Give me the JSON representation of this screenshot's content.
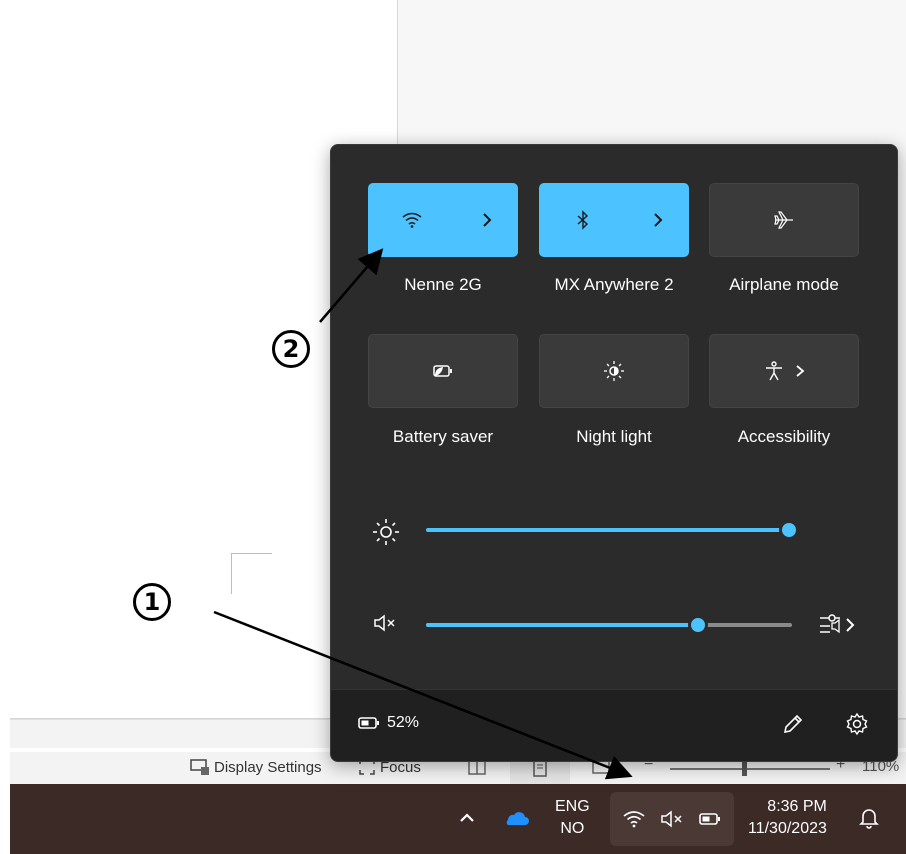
{
  "document": {},
  "statusbar": {
    "display_settings_label": "Display Settings",
    "focus_label": "Focus",
    "zoom_minus": "−",
    "zoom_plus": "+",
    "zoom_level": "110%"
  },
  "quick_settings": {
    "tiles": [
      {
        "label": "Nenne 2G",
        "state": "on",
        "icon": "wifi-icon",
        "has_arrow": true
      },
      {
        "label": "MX Anywhere 2",
        "state": "on",
        "icon": "bluetooth-icon",
        "has_arrow": true
      },
      {
        "label": "Airplane mode",
        "state": "off",
        "icon": "airplane-icon",
        "has_arrow": false
      },
      {
        "label": "Battery saver",
        "state": "off",
        "icon": "battery-saver-icon",
        "has_arrow": false
      },
      {
        "label": "Night light",
        "state": "off",
        "icon": "night-light-icon",
        "has_arrow": false
      },
      {
        "label": "Accessibility",
        "state": "off",
        "icon": "accessibility-icon",
        "has_arrow": true
      }
    ],
    "brightness": {
      "icon": "brightness-icon",
      "level": 1.0
    },
    "volume": {
      "icon": "volume-muted-icon",
      "level": 0.7,
      "output_icon": "audio-output-icon"
    },
    "footer": {
      "battery_percent": "52%",
      "edit_icon": "pencil-icon",
      "settings_icon": "gear-icon"
    }
  },
  "taskbar": {
    "overflow_icon": "chevron-up-icon",
    "cloud_icon": "onedrive-icon",
    "language_line1": "ENG",
    "language_line2": "NO",
    "time": "8:36 PM",
    "date": "11/30/2023",
    "notification_icon": "bell-icon"
  },
  "annotations": {
    "marker1": "1",
    "marker2": "2"
  },
  "colors": {
    "accent": "#4cc2ff",
    "flyout_bg": "#2b2b2b",
    "taskbar_bg": "#3b2a26"
  }
}
